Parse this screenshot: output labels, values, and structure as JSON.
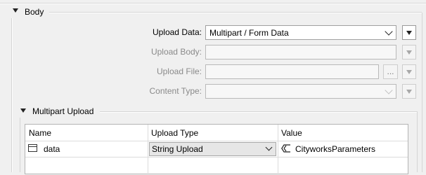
{
  "body_section": {
    "title": "Body",
    "upload_data": {
      "label": "Upload Data:",
      "value": "Multipart / Form Data"
    },
    "upload_body": {
      "label": "Upload Body:",
      "value": ""
    },
    "upload_file": {
      "label": "Upload File:",
      "value": "",
      "browse_label": "..."
    },
    "content_type": {
      "label": "Content Type:",
      "value": ""
    }
  },
  "multipart_section": {
    "title": "Multipart Upload",
    "columns": [
      "Name",
      "Upload Type",
      "Value"
    ],
    "rows": [
      {
        "name": "data",
        "upload_type": "String Upload",
        "value": "CityworksParameters"
      }
    ]
  },
  "colors": {
    "window_bg": "#f0f0f0",
    "field_border": "#b9b9b9",
    "disabled_text": "#8a8a8a"
  }
}
